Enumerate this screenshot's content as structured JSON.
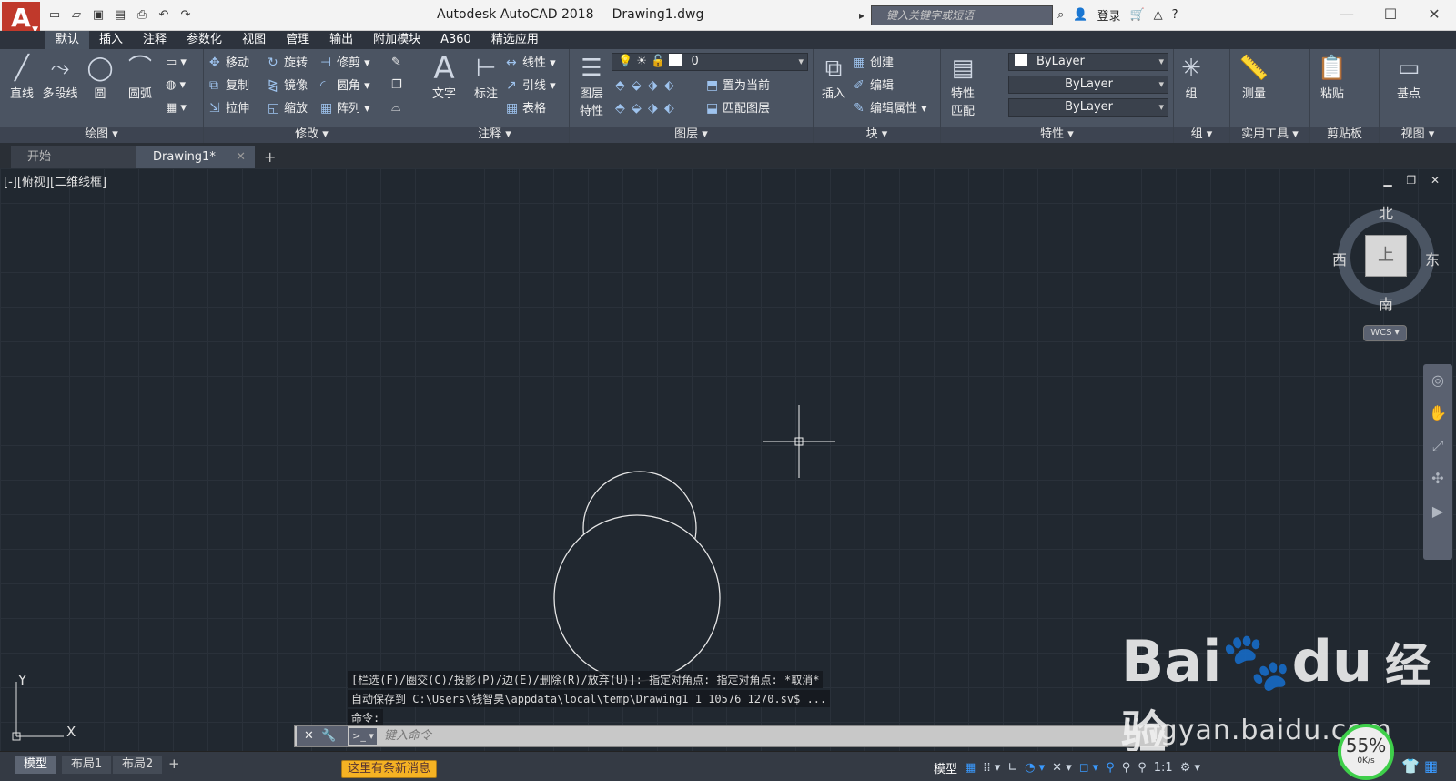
{
  "titlebar": {
    "app_title": "Autodesk AutoCAD 2018",
    "doc_title": "Drawing1.dwg",
    "search_placeholder": "键入关键字或短语",
    "login": "登录",
    "qat_icons": [
      "new-icon",
      "open-icon",
      "save-icon",
      "saveas-icon",
      "print-icon",
      "undo-icon",
      "redo-icon"
    ]
  },
  "ribbon_tabs": [
    "默认",
    "插入",
    "注释",
    "参数化",
    "视图",
    "管理",
    "输出",
    "附加模块",
    "A360",
    "精选应用"
  ],
  "ribbon": {
    "draw": {
      "title": "绘图",
      "line": "直线",
      "polyline": "多段线",
      "circle": "圆",
      "arc": "圆弧"
    },
    "modify": {
      "title": "修改",
      "move": "移动",
      "rotate": "旋转",
      "trim": "修剪",
      "copy": "复制",
      "mirror": "镜像",
      "fillet": "圆角",
      "stretch": "拉伸",
      "scale": "缩放",
      "array": "阵列"
    },
    "annotation": {
      "title": "注释",
      "text": "文字",
      "dimension": "标注",
      "linear": "线性",
      "leader": "引线",
      "table": "表格"
    },
    "layers": {
      "title": "图层",
      "layer_props_1": "图层",
      "layer_props_2": "特性",
      "current_layer": "0",
      "make_current": "置为当前",
      "match_layer": "匹配图层"
    },
    "block": {
      "title": "块",
      "insert": "插入",
      "create": "创建",
      "edit": "编辑",
      "edit_attr": "编辑属性"
    },
    "properties": {
      "title": "特性",
      "match_1": "特性",
      "match_2": "匹配",
      "color": "ByLayer",
      "linetype": "ByLayer",
      "lineweight": "ByLayer"
    },
    "groups": {
      "title": "组",
      "group": "组"
    },
    "utilities": {
      "title": "实用工具",
      "measure": "测量"
    },
    "clipboard": {
      "title": "剪贴板",
      "paste": "粘贴"
    },
    "view": {
      "title": "视图",
      "base": "基点"
    }
  },
  "doc_tabs": [
    "开始",
    "Drawing1*"
  ],
  "viewport": {
    "label": "[-][俯视][二维线框]",
    "viewcube": {
      "top": "上",
      "north": "北",
      "south": "南",
      "east": "东",
      "west": "西",
      "wcs": "WCS"
    },
    "ucs": {
      "x": "X",
      "y": "Y"
    }
  },
  "command": {
    "history": [
      "[栏选(F)/圈交(C)/投影(P)/边(E)/删除(R)/放弃(U)]:  指定对角点: 指定对角点: *取消*",
      "自动保存到 C:\\Users\\钱智昊\\appdata\\local\\temp\\Drawing1_1_10576_1270.sv$ ...",
      "命令:"
    ],
    "placeholder": "键入命令"
  },
  "statusbar": {
    "layouts": [
      "模型",
      "布局1",
      "布局2"
    ],
    "toast": "这里有条新消息",
    "model": "模型",
    "scale": "1:1"
  },
  "watermark": {
    "brand": "Bai",
    "brand2": "du",
    "cn": "经验",
    "url": "jingyan.baidu.com"
  },
  "perf": {
    "value": "55%",
    "rate": "0K/s"
  }
}
